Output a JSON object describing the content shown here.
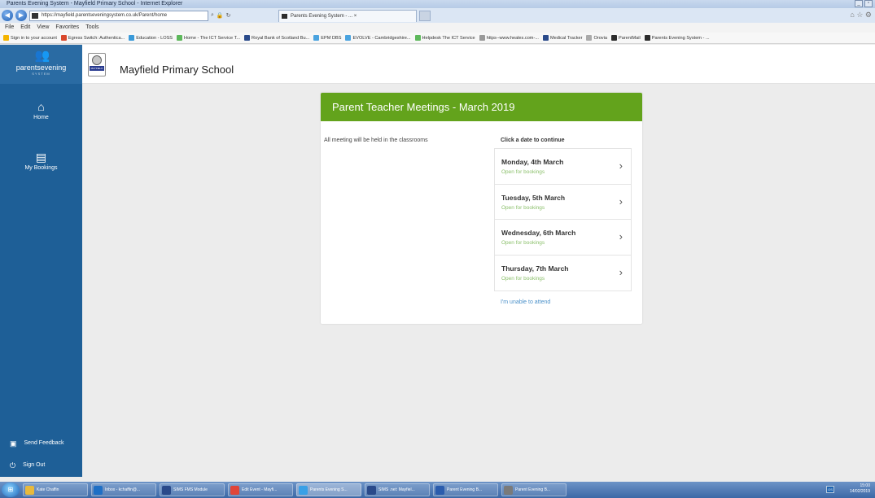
{
  "browser": {
    "window_title": "Parents Evening System - Mayfield Primary School - Internet Explorer",
    "url": "https://mayfield.parentseveningsystem.co.uk/Parent/home",
    "tab_title": "Parents Evening System - ... ×",
    "menu": [
      "File",
      "Edit",
      "View",
      "Favorites",
      "Tools"
    ],
    "favorites": [
      {
        "label": "Sign in to your account",
        "color": "#f4b400"
      },
      {
        "label": "Egress Switch: Authentica...",
        "color": "#d9472b"
      },
      {
        "label": "Education - LOSS",
        "color": "#3a9ad9"
      },
      {
        "label": "Home - The ICT Service T...",
        "color": "#5db85b"
      },
      {
        "label": "Royal Bank of Scotland Bu...",
        "color": "#2a4a8a"
      },
      {
        "label": "EPM DBS",
        "color": "#4aa3df"
      },
      {
        "label": "EVOLVE - Cambridgeshire...",
        "color": "#4aa3df"
      },
      {
        "label": "Helpdesk The ICT Service",
        "color": "#5db85b"
      },
      {
        "label": "https--www.heales.com-...",
        "color": "#999999"
      },
      {
        "label": "Medical Tracker",
        "color": "#2a4a8a"
      },
      {
        "label": "Orovia",
        "color": "#aaaaaa"
      },
      {
        "label": "ParentMail",
        "color": "#2b2b2b"
      },
      {
        "label": "Parents Evening System - ...",
        "color": "#2b2b2b"
      }
    ]
  },
  "sidebar": {
    "brand": "parentsevening",
    "brand_sub": "SYSTEM",
    "items": [
      {
        "label": "Home",
        "icon": "home-icon"
      },
      {
        "label": "My Bookings",
        "icon": "document-icon"
      }
    ],
    "bottom": [
      {
        "label": "Send Feedback",
        "icon": "feedback-icon"
      },
      {
        "label": "Sign Out",
        "icon": "power-icon"
      }
    ]
  },
  "header": {
    "school_name": "Mayfield Primary School",
    "logo_text": "MAYFIELD"
  },
  "card": {
    "title": "Parent Teacher Meetings - March 2019",
    "note": "All meeting will be held in the classrooms",
    "choose_label": "Click a date to continue",
    "dates": [
      {
        "date": "Monday, 4th March",
        "status": "Open for bookings"
      },
      {
        "date": "Tuesday, 5th March",
        "status": "Open for bookings"
      },
      {
        "date": "Wednesday, 6th March",
        "status": "Open for bookings"
      },
      {
        "date": "Thursday, 7th March",
        "status": "Open for bookings"
      }
    ],
    "unable": "I'm unable to attend",
    "accent_color": "#63a31c"
  },
  "taskbar": {
    "items": [
      {
        "label": "Kate Chaffin",
        "color": "#e8b93c"
      },
      {
        "label": "Inbox - kchaffin@...",
        "color": "#1f6fc5"
      },
      {
        "label": "SIMS FMS Module",
        "color": "#2a4a8a"
      },
      {
        "label": "Edit Event - Mayfi...",
        "color": "#e0463a"
      },
      {
        "label": "Parents Evening S...",
        "color": "#3aa0e6"
      },
      {
        "label": "SIMS .net: Mayfiel...",
        "color": "#2a4a8a"
      },
      {
        "label": "Parent Evening B...",
        "color": "#2b5cad"
      },
      {
        "label": "Parent Evening B...",
        "color": "#7a7a7a"
      }
    ],
    "time": "15:00",
    "date": "14/02/2019"
  }
}
